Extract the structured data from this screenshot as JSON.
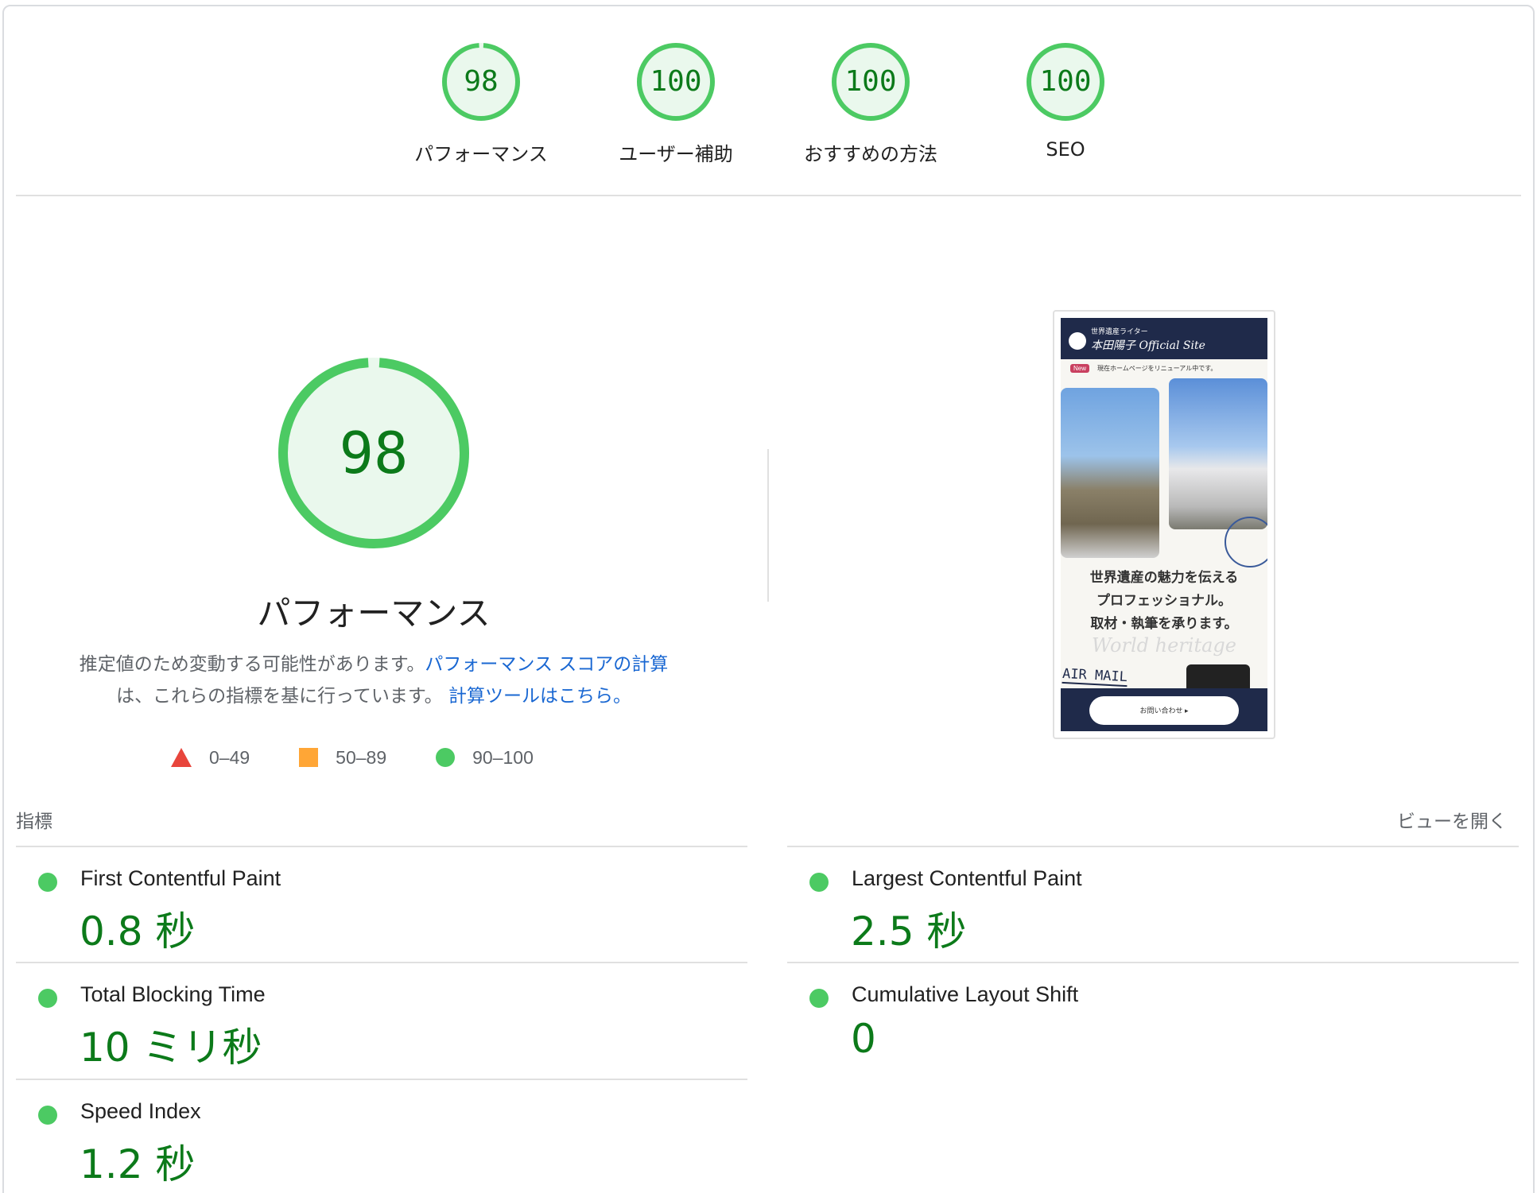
{
  "categories": [
    {
      "score": "98",
      "label": "パフォーマンス",
      "fraction": 0.98
    },
    {
      "score": "100",
      "label": "ユーザー補助",
      "fraction": 1.0
    },
    {
      "score": "100",
      "label": "おすすめの方法",
      "fraction": 1.0
    },
    {
      "score": "100",
      "label": "SEO",
      "fraction": 1.0
    }
  ],
  "main": {
    "score": "98",
    "fraction": 0.98,
    "title": "パフォーマンス",
    "desc_text1": "推定値のため変動する可能性があります。",
    "desc_link1": "パフォーマンス スコアの計算",
    "desc_text2": "は、これらの指標を基に行っています。",
    "desc_link2": "計算ツールはこちら。"
  },
  "legend": {
    "fail": "0–49",
    "average": "50–89",
    "pass": "90–100"
  },
  "screenshot": {
    "header_small": "世界遺産ライター",
    "header_title": "本田陽子 Official Site",
    "badge": "New",
    "news": "現在ホームページをリニューアル中です。",
    "tagline_1": "世界遺産の魅力を伝える",
    "tagline_2": "プロフェッショナル。",
    "tagline_3": "取材・執筆を承ります。",
    "script_text": "World heritage",
    "airmail": "AIR MAIL",
    "button": "お問い合わせ ▸"
  },
  "metrics_section": {
    "heading": "指標",
    "toggle": "ビューを開く"
  },
  "metrics": [
    {
      "name": "First Contentful Paint",
      "value": "0.8 秒"
    },
    {
      "name": "Largest Contentful Paint",
      "value": "2.5 秒"
    },
    {
      "name": "Total Blocking Time",
      "value": "10 ミリ秒"
    },
    {
      "name": "Cumulative Layout Shift",
      "value": "0"
    },
    {
      "name": "Speed Index",
      "value": "1.2 秒"
    }
  ],
  "colors": {
    "pass": "#0c7a1a",
    "pass_arc": "#4cca63",
    "pass_fill": "#eaf8ed",
    "link": "#1967d2",
    "fail": "#e8453c",
    "average": "#ffa636"
  }
}
